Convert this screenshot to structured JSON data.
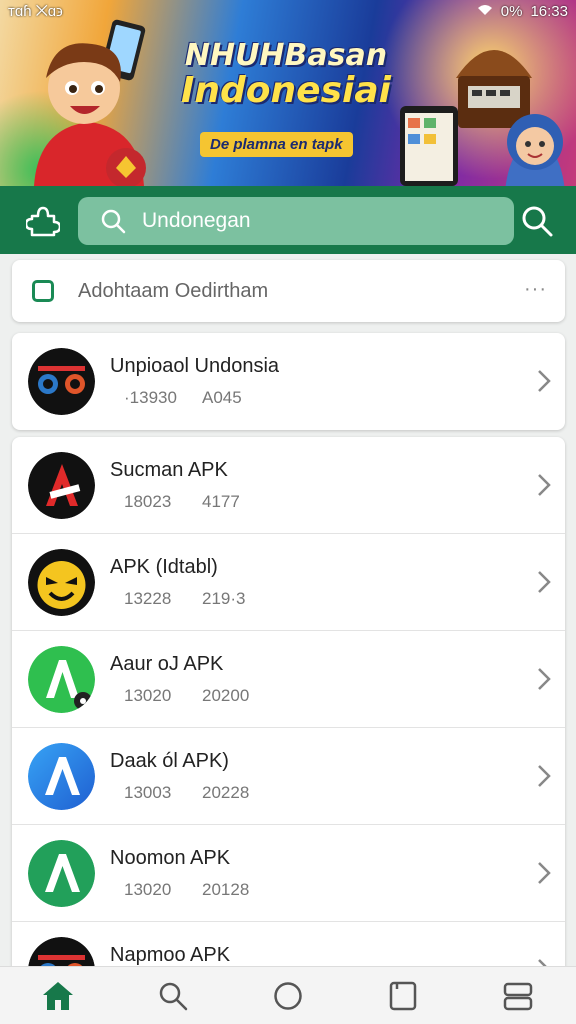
{
  "status_bar": {
    "left_text": "ᴛɑɦ ⨉ɑ϶",
    "battery": "0%",
    "time": "16:33"
  },
  "banner": {
    "title_line1": "NHUHBasan",
    "title_line2": "Indonesiai",
    "subtitle": "De plamna en tapk"
  },
  "search": {
    "placeholder": "Undonegan",
    "value": ""
  },
  "filter": {
    "label": "Adohtaam Oedirtham",
    "more": "···"
  },
  "featured": {
    "title": "Unpioaol Undonsia",
    "meta1": "·13930",
    "meta2": "A045"
  },
  "apps": [
    {
      "title": "Sucman APK",
      "meta1": "18023",
      "meta2": "4177"
    },
    {
      "title": "APK (Idtabl)",
      "meta1": "13228",
      "meta2": "219·3"
    },
    {
      "title": "Aaur oJ APK",
      "meta1": "13020",
      "meta2": "20200"
    },
    {
      "title": "Daak ól APK)",
      "meta1": "13003",
      "meta2": "20228"
    },
    {
      "title": "Noomon APK",
      "meta1": "13020",
      "meta2": "20128"
    },
    {
      "title": "Napmoo APK",
      "meta1": "",
      "meta2": ""
    }
  ],
  "colors": {
    "primary": "#17784a",
    "search_field": "#7cc1a0",
    "card": "#ffffff",
    "background": "#eef0ef"
  },
  "icons": {
    "header_left": "puzzle-icon",
    "search_field": "search-icon",
    "search_action": "search-icon",
    "nav": [
      "home-icon",
      "search-icon",
      "circle-icon",
      "square-icon",
      "recents-icon"
    ]
  }
}
